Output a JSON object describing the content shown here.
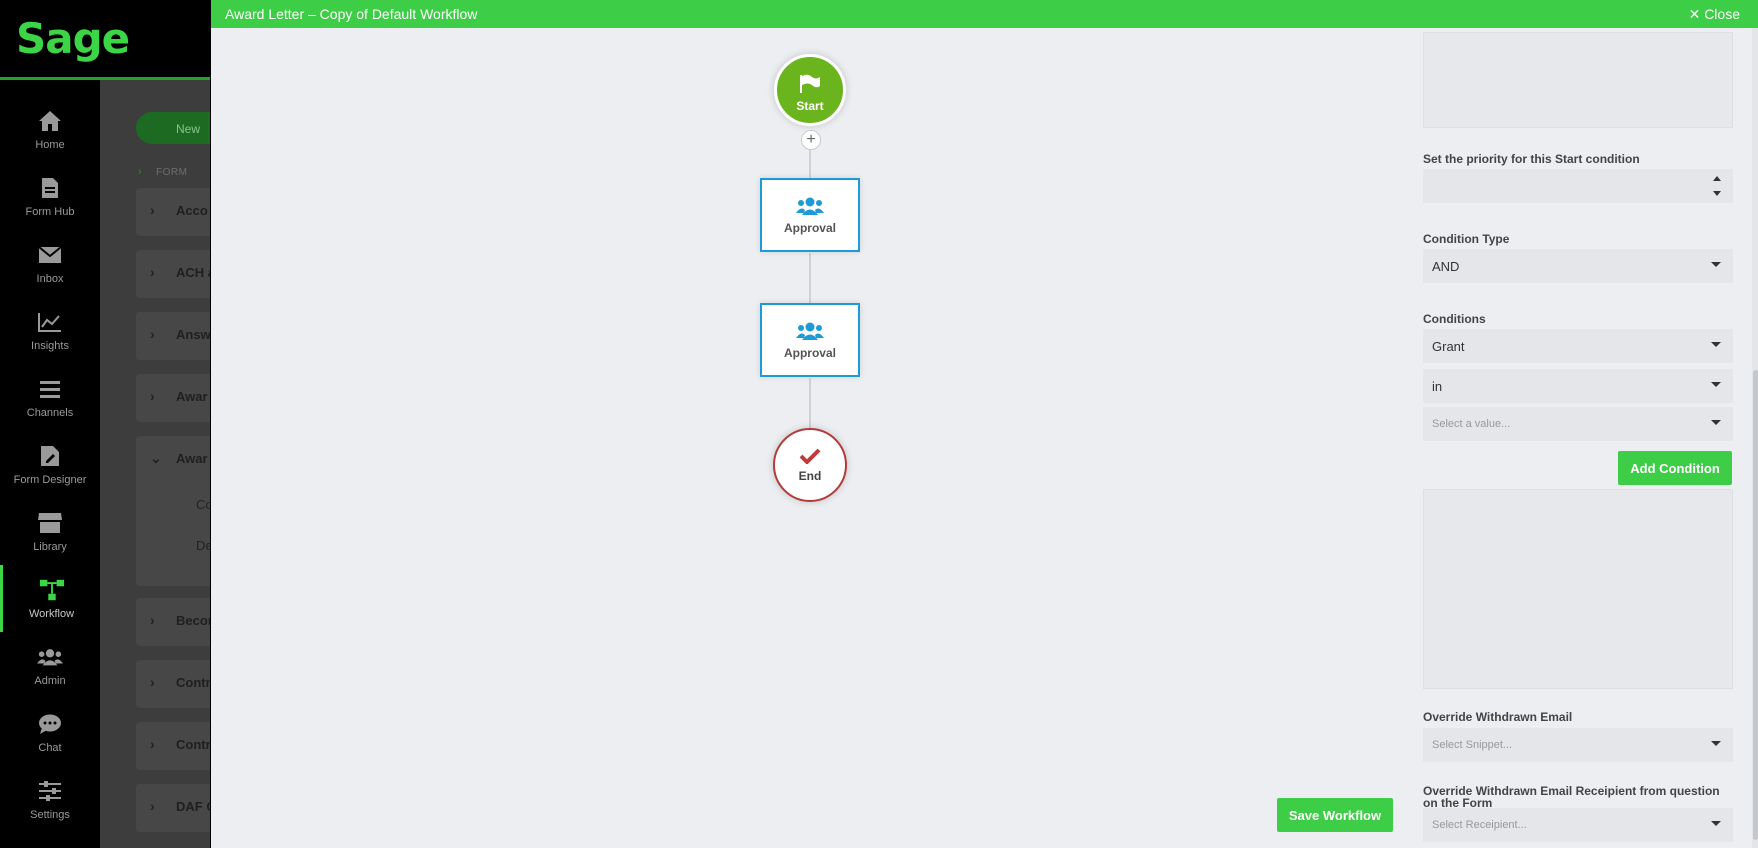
{
  "brand": {
    "logo_text": "Sage",
    "accent": "#3ecd47"
  },
  "nav": {
    "items": [
      {
        "label": "Home",
        "icon": "home-icon"
      },
      {
        "label": "Form Hub",
        "icon": "document-icon"
      },
      {
        "label": "Inbox",
        "icon": "mail-icon"
      },
      {
        "label": "Insights",
        "icon": "chart-icon"
      },
      {
        "label": "Channels",
        "icon": "list-icon"
      },
      {
        "label": "Form Designer",
        "icon": "edit-document-icon"
      },
      {
        "label": "Library",
        "icon": "store-icon"
      },
      {
        "label": "Workflow",
        "icon": "workflow-icon",
        "active": true
      },
      {
        "label": "Admin",
        "icon": "users-icon"
      },
      {
        "label": "Chat",
        "icon": "chat-icon"
      },
      {
        "label": "Settings",
        "icon": "sliders-icon"
      }
    ]
  },
  "background_page": {
    "new_button": "New",
    "breadcrumb": "FORM",
    "rows": [
      "Acco",
      "ACH a",
      "Answ",
      "Awar",
      "Awar",
      "Becon",
      "Contr",
      "Contr",
      "DAF C"
    ],
    "sub_items": [
      "Co",
      "De"
    ]
  },
  "modal": {
    "title": "Award Letter – Copy of Default Workflow",
    "close_label": "✕ Close",
    "workflow": {
      "start_label": "Start",
      "approval_1_label": "Approval",
      "approval_2_label": "Approval",
      "end_label": "End"
    },
    "save_label": "Save Workflow",
    "panel": {
      "priority_label": "Set the priority for this Start condition",
      "priority_value": "",
      "condition_type_label": "Condition Type",
      "condition_type_value": "AND",
      "conditions_label": "Conditions",
      "condition_field": "Grant",
      "condition_operator": "in",
      "condition_value_placeholder": "Select a value...",
      "add_condition_label": "Add Condition",
      "override_email_label": "Override Withdrawn Email",
      "override_email_placeholder": "Select Snippet...",
      "override_recipient_label": "Override Withdrawn Email Receipient from question on the Form",
      "override_recipient_placeholder": "Select Receipient..."
    }
  }
}
